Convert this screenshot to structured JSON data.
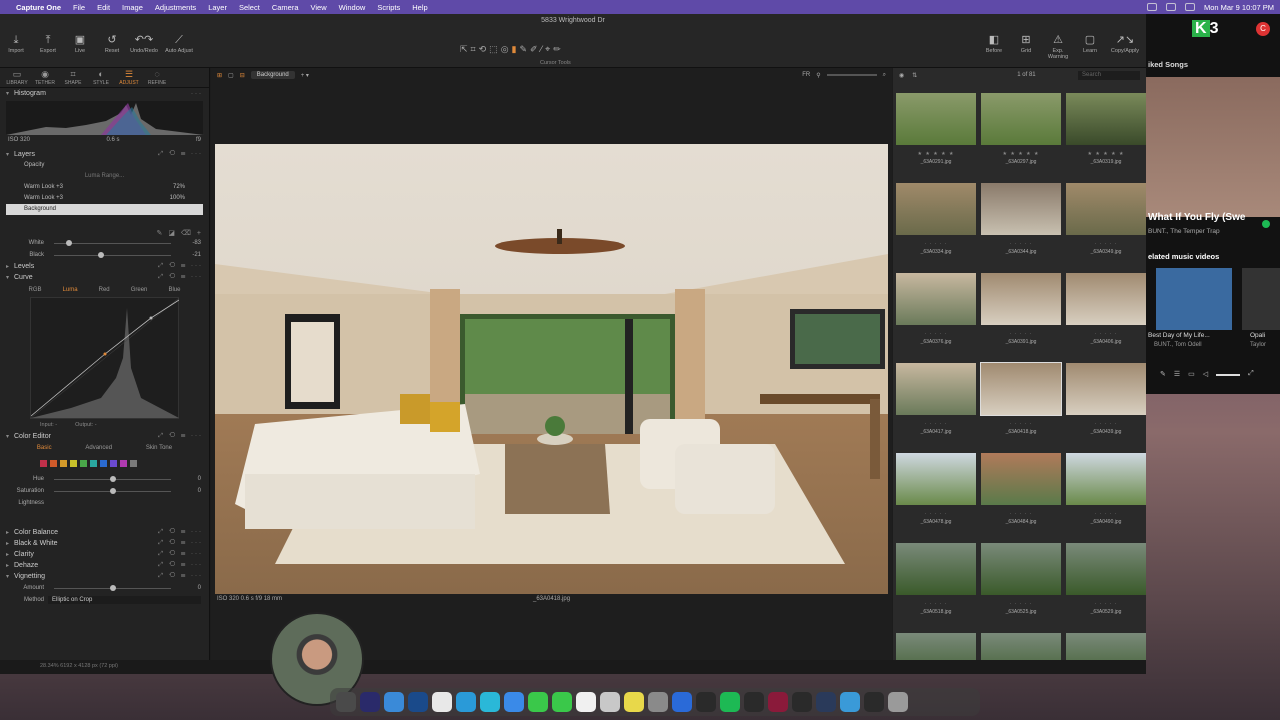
{
  "menubar": {
    "app_name": "Capture One",
    "menus": [
      "File",
      "Edit",
      "Image",
      "Adjustments",
      "Layer",
      "Select",
      "Camera",
      "View",
      "Window",
      "Scripts",
      "Help"
    ],
    "clock": "Mon Mar 9  10:07 PM"
  },
  "window": {
    "title": "5833 Wrightwood Dr"
  },
  "toolbar": {
    "left_buttons": [
      "Import",
      "Export",
      "Live",
      "Reset",
      "Undo/Redo",
      "Auto Adjust"
    ],
    "cursor_tools_label": "Cursor Tools",
    "right_buttons": [
      "Before",
      "Grid",
      "Exp. Warning",
      "Learn",
      "Copy/Apply"
    ]
  },
  "tooltabs": [
    "LIBRARY",
    "TETHER",
    "SHAPE",
    "STYLE",
    "ADJUST",
    "REFINE"
  ],
  "histogram": {
    "title": "Histogram",
    "iso": "ISO 320",
    "shutter": "0.6 s",
    "aperture": "f9"
  },
  "layers": {
    "title": "Layers",
    "opacity_label": "Opacity",
    "luma_range_label": "Luma Range...",
    "items": [
      {
        "name": "Warm Look +3",
        "percent": "72%"
      },
      {
        "name": "Warm Look +3",
        "percent": "100%"
      },
      {
        "name": "Background",
        "percent": ""
      }
    ]
  },
  "exposure_partial": {
    "white_label": "White",
    "white_value": "-83",
    "black_label": "Black",
    "black_value": "-21"
  },
  "levels": {
    "title": "Levels"
  },
  "curve": {
    "title": "Curve",
    "tabs": [
      "RGB",
      "Luma",
      "Red",
      "Green",
      "Blue"
    ],
    "active_tab": "Luma",
    "input_label": "Input:",
    "input_value": "-",
    "output_label": "Output:",
    "output_value": "-"
  },
  "color_editor": {
    "title": "Color Editor",
    "tabs": [
      "Basic",
      "Advanced",
      "Skin Tone"
    ],
    "active_tab": "Basic",
    "swatch_colors": [
      "#c0304a",
      "#d05a2a",
      "#d49a2a",
      "#c8c02a",
      "#4aa84a",
      "#2aa8a0",
      "#2a6ad0",
      "#6a4ad0",
      "#b03ab0",
      "#7a7a7a"
    ],
    "sliders": [
      {
        "label": "Hue",
        "value": "0"
      },
      {
        "label": "Saturation",
        "value": "0"
      },
      {
        "label": "Lightness",
        "value": "0"
      }
    ]
  },
  "collapsed_tools": [
    "Color Balance",
    "Black & White",
    "Clarity",
    "Dehaze",
    "Vignetting"
  ],
  "vignetting": {
    "amount_label": "Amount",
    "amount_value": "0",
    "method_label": "Method",
    "method_value": "Elliptic on Crop"
  },
  "viewer": {
    "variant_name": "Background",
    "photo_meta": "ISO 320    0.6 s    f/9    18 mm",
    "photo_name": "_63A0418.jpg"
  },
  "browser": {
    "count": "1 of 81",
    "search_placeholder": "Search",
    "thumbnails": [
      {
        "name": "_63A0291.jpg",
        "stars": "★ ★ ★ ★ ★",
        "scene": "garden"
      },
      {
        "name": "_63A0297.jpg",
        "stars": "★ ★ ★ ★ ★",
        "scene": "garden"
      },
      {
        "name": "_63A0319.jpg",
        "stars": "★ ★ ★ ★ ★",
        "scene": "path"
      },
      {
        "name": "_63A0334.jpg",
        "stars": "· · · · ·",
        "scene": "yard"
      },
      {
        "name": "_63A0344.jpg",
        "stars": "· · · · ·",
        "scene": "house"
      },
      {
        "name": "_63A0349.jpg",
        "stars": "· · · · ·",
        "scene": "yard"
      },
      {
        "name": "_63A0376.jpg",
        "stars": "· · · · ·",
        "scene": "patio"
      },
      {
        "name": "_63A0391.jpg",
        "stars": "· · · · ·",
        "scene": "interior"
      },
      {
        "name": "_63A0406.jpg",
        "stars": "· · · · ·",
        "scene": "interior"
      },
      {
        "name": "_63A0417.jpg",
        "stars": "· · · · ·",
        "scene": "patio"
      },
      {
        "name": "_63A0418.jpg",
        "stars": "· · · · ·",
        "scene": "interior"
      },
      {
        "name": "_63A0439.jpg",
        "stars": "· · · · ·",
        "scene": "interior"
      },
      {
        "name": "_63A0478.jpg",
        "stars": "· · · · ·",
        "scene": "lawn"
      },
      {
        "name": "_63A0484.jpg",
        "stars": "· · · · ·",
        "scene": "pool"
      },
      {
        "name": "_63A0490.jpg",
        "stars": "· · · · ·",
        "scene": "lawn"
      },
      {
        "name": "_63A0518.jpg",
        "stars": "· · · · ·",
        "scene": "aerial"
      },
      {
        "name": "_63A0525.jpg",
        "stars": "· · · · ·",
        "scene": "aerial"
      },
      {
        "name": "_63A0529.jpg",
        "stars": "· · · · ·",
        "scene": "aerial"
      },
      {
        "name": "",
        "stars": "",
        "scene": "aerial"
      },
      {
        "name": "",
        "stars": "",
        "scene": "aerial"
      },
      {
        "name": "",
        "stars": "",
        "scene": "aerial"
      }
    ],
    "selected_index": 10
  },
  "status": {
    "text": "28.34%     6192 x 4128 px (72 ppi)"
  },
  "spotify": {
    "header": "iked Songs",
    "song": "What If You Fly (Swe",
    "artist": "BUNT., The Temper Trap",
    "related": "elated music videos",
    "videos": [
      {
        "title": "Best Day of My Life...",
        "sub": "BUNT., Tom Odell"
      },
      {
        "title": "Opali",
        "sub": "Taylor"
      }
    ]
  },
  "k3_label": "3",
  "rec_label": "C"
}
